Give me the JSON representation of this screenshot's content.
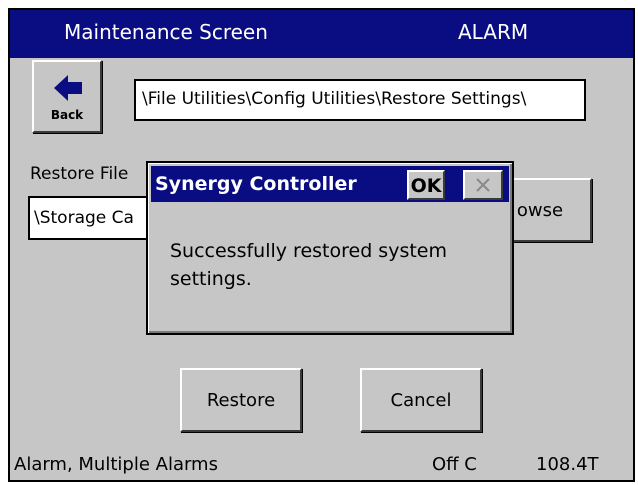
{
  "header": {
    "title": "Maintenance Screen",
    "alarm_label": "ALARM"
  },
  "toolbar": {
    "back_label": "Back",
    "back_icon": "left-arrow-icon"
  },
  "path": {
    "value": "\\File Utilities\\Config Utilities\\Restore Settings\\"
  },
  "restore": {
    "label": "Restore File",
    "file_value": "\\Storage Ca",
    "browse_label": "owse"
  },
  "actions": {
    "restore_label": "Restore",
    "cancel_label": "Cancel"
  },
  "status": {
    "alarm_text": "Alarm, Multiple Alarms",
    "mode_text": "Off C",
    "value_text": "108.4T"
  },
  "dialog": {
    "title": "Synergy Controller",
    "ok_label": "OK",
    "close_icon": "close-icon",
    "message": "Successfully restored system settings."
  },
  "colors": {
    "titlebar_bg": "#0a0c82",
    "panel_bg": "#c6c6c6"
  }
}
